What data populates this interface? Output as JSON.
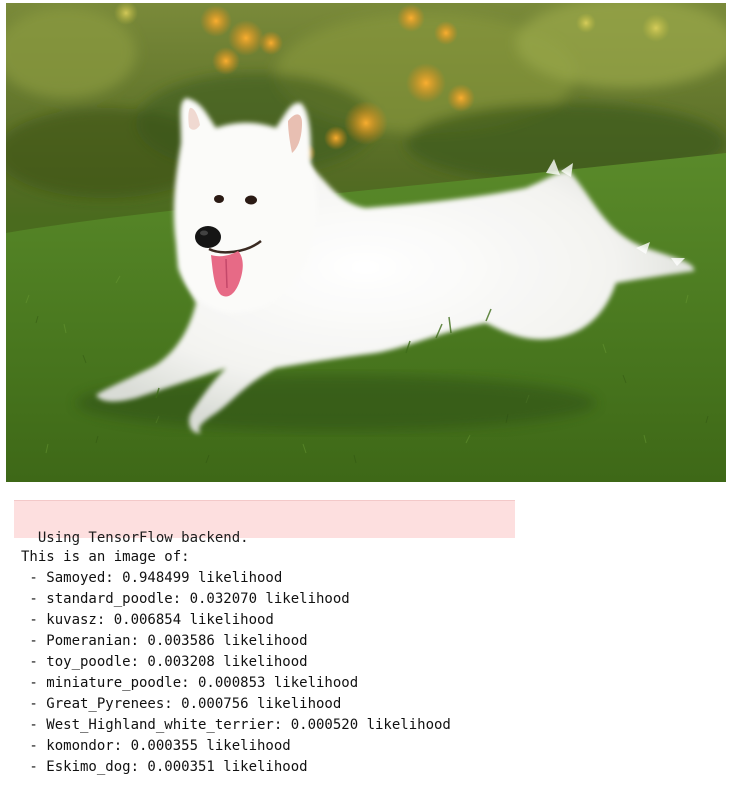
{
  "image": {
    "subject": "white fluffy dog lying on grass",
    "colors": {
      "grass": "#4f7d24",
      "dog": "#f7f7f5",
      "bokeh_orange": "#f0a020"
    }
  },
  "stderr": {
    "text": "Using TensorFlow backend.",
    "bg_color": "#fddfdf"
  },
  "output": {
    "header": "This is an image of:",
    "predictions": [
      {
        "text": " - Samoyed: 0.948499 likelihood"
      },
      {
        "text": " - standard_poodle: 0.032070 likelihood"
      },
      {
        "text": " - kuvasz: 0.006854 likelihood"
      },
      {
        "text": " - Pomeranian: 0.003586 likelihood"
      },
      {
        "text": " - toy_poodle: 0.003208 likelihood"
      },
      {
        "text": " - miniature_poodle: 0.000853 likelihood"
      },
      {
        "text": " - Great_Pyrenees: 0.000756 likelihood"
      },
      {
        "text": " - West_Highland_white_terrier: 0.000520 likelihood"
      },
      {
        "text": " - komondor: 0.000355 likelihood"
      },
      {
        "text": " - Eskimo_dog: 0.000351 likelihood"
      }
    ]
  }
}
